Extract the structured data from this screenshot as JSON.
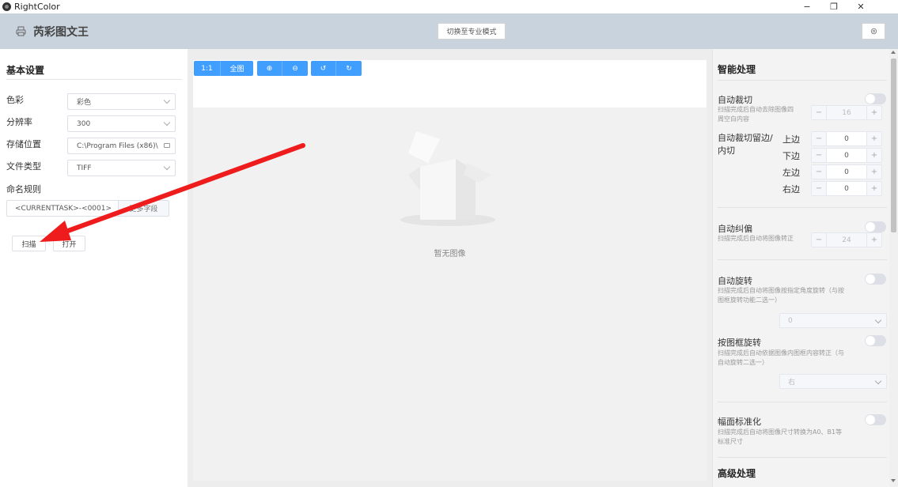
{
  "window": {
    "title": "RightColor",
    "minimize": "−",
    "maximize": "❐",
    "close": "✕"
  },
  "header": {
    "brand": "芮彩图文王",
    "mode_button": "切换至专业模式",
    "settings_icon": "gear-icon"
  },
  "basic": {
    "title": "基本设置",
    "fields": [
      {
        "label": "色彩",
        "value": "彩色"
      },
      {
        "label": "分辨率",
        "value": "300"
      },
      {
        "label": "存储位置",
        "value": "C:\\Program Files (x86)\\"
      },
      {
        "label": "文件类型",
        "value": "TIFF"
      }
    ],
    "naming_label": "命名规则",
    "naming_value": "<CURRENTTASK>-<0001>",
    "naming_button": "更多字段",
    "scan_button": "扫描",
    "open_button": "打开"
  },
  "viewer": {
    "toolbar": {
      "fit_1to1": "1:1",
      "full": "全图",
      "zoom_in": "⊕",
      "zoom_out": "⊖",
      "rotate_left": "↺",
      "rotate_right": "↻"
    },
    "empty_text": "暂无图像"
  },
  "smart": {
    "title": "智能处理",
    "auto_crop": {
      "label": "自动裁切",
      "desc1": "扫描完成后自动去除图像四",
      "desc2": "周空白内容",
      "value": "16",
      "minus": "−",
      "plus": "+"
    },
    "margin": {
      "label1": "自动裁切留边/",
      "label2": "内切",
      "edges": [
        {
          "label": "上边",
          "value": "0"
        },
        {
          "label": "下边",
          "value": "0"
        },
        {
          "label": "左边",
          "value": "0"
        },
        {
          "label": "右边",
          "value": "0"
        }
      ],
      "minus": "−",
      "plus": "+"
    },
    "deskew": {
      "label": "自动纠偏",
      "desc": "扫描完成后自动将图像转正",
      "value": "24"
    },
    "auto_rotate": {
      "label": "自动旋转",
      "desc1": "扫描完成后自动将图像按指定角度旋转（与按",
      "desc2": "图框旋转功能二选一）",
      "value": "0"
    },
    "frame_rotate": {
      "label": "按图框旋转",
      "desc1": "扫描完成后自动依据图像内图框内容转正（与",
      "desc2": "自动旋转二选一）",
      "value": "右"
    },
    "standardize": {
      "label": "幅面标准化",
      "desc1": "扫描完成后自动将图像尺寸转换为A0、B1等",
      "desc2": "标准尺寸"
    },
    "advanced_title": "高级处理"
  },
  "colors": {
    "accent": "#409eff",
    "header_bg": "#c9d3dd",
    "annotation_arrow": "#ee1c1c"
  }
}
